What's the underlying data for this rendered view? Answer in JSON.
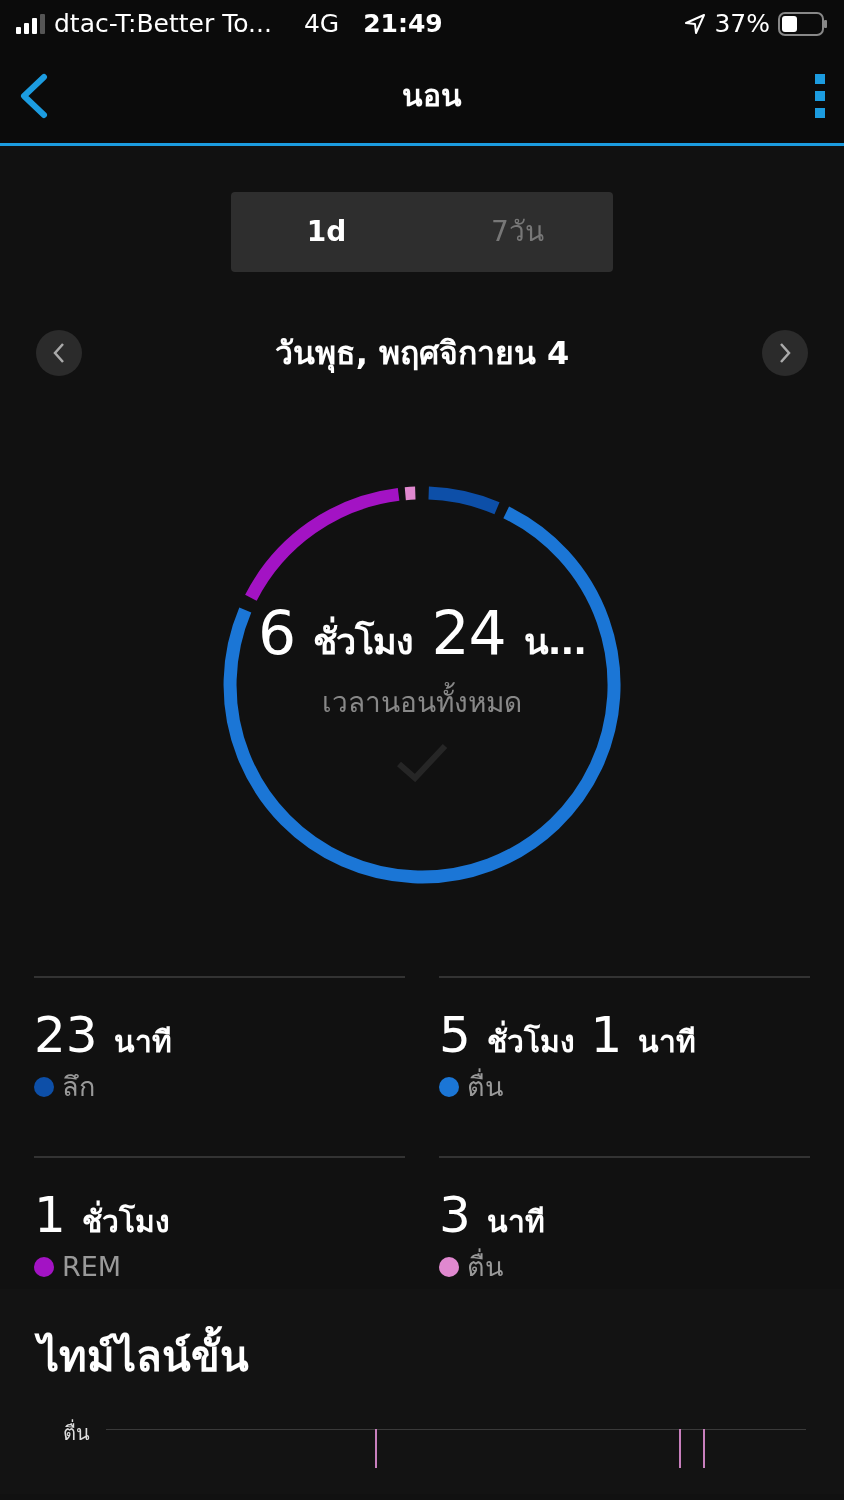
{
  "status_bar": {
    "carrier": "dtac-T:Better To...",
    "network": "4G",
    "time": "21:49",
    "battery": "37%"
  },
  "nav": {
    "title": "นอน"
  },
  "tabs": [
    {
      "label": "1d",
      "selected": true
    },
    {
      "label": "7วัน",
      "selected": false
    }
  ],
  "date": "วันพุธ, พฤศจิกายน 4",
  "summary": {
    "value": "6",
    "unit": "ชั่วโมง",
    "value2": "24",
    "unit2": "น...",
    "label": "เวลานอนทั้งหมด"
  },
  "stats": [
    {
      "value": "23",
      "unit": "นาที",
      "label": "ลึก",
      "color": "#0d4fa8"
    },
    {
      "value": "5",
      "unit": "ชั่วโมง",
      "value2": "1",
      "unit2": "นาที",
      "label": "ตื่น",
      "color": "#1b76d6"
    },
    {
      "value": "1",
      "unit": "ชั่วโมง",
      "label": "REM",
      "color": "#a313c4"
    },
    {
      "value": "3",
      "unit": "นาที",
      "label": "ตื่น",
      "color": "#e088cf"
    }
  ],
  "timeline": {
    "title": "ไทม์ไลน์ขั้น",
    "row_label": "ตื่น"
  }
}
